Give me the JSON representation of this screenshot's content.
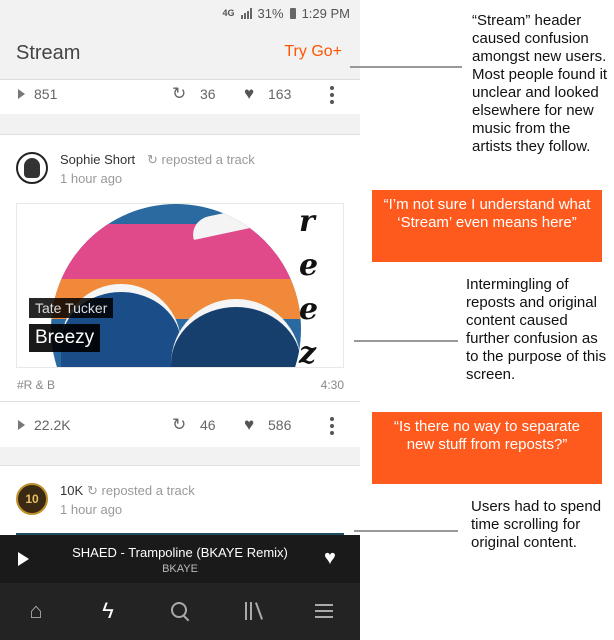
{
  "status_bar": {
    "network": "4G",
    "battery": "31%",
    "time": "1:29 PM"
  },
  "header": {
    "title": "Stream",
    "try_go": "Try Go+"
  },
  "top_actions": {
    "plays": "851",
    "reposts": "36",
    "likes": "163"
  },
  "posts": [
    {
      "user": "Sophie Short",
      "action": "reposted a track",
      "time": "1 hour ago",
      "artist": "Tate Tucker",
      "track": "Breezy",
      "art_glyphs": [
        "r",
        "e",
        "e",
        "z"
      ],
      "tag": "#R & B",
      "duration": "4:30",
      "plays": "22.2K",
      "reposts": "46",
      "likes": "586"
    },
    {
      "user": "10K",
      "action": "reposted a track",
      "time": "1 hour ago",
      "avatar_text": "10"
    }
  ],
  "player": {
    "title": "SHAED - Trampoline (BKAYE Remix)",
    "artist": "BKAYE"
  },
  "icons": {
    "repost": "↻",
    "heart": "♥",
    "home": "⌂",
    "bolt": "ϟ"
  },
  "annotations": {
    "note1": "“Stream” header caused confusion amongst new users. Most people found it unclear and looked elsewhere for new music from  the artists they follow.",
    "quote1": "“I’m not sure I understand what ‘Stream’ even means here”",
    "note2": "Intermingling of reposts and original content caused further confusion as to the purpose of this screen.",
    "quote2": "“Is there no way to separate new stuff from reposts?”",
    "note3": "Users had to spend time scrolling for original content."
  },
  "colors": {
    "accent": "#ff5500",
    "quote_bg": "#ff5a1e",
    "player_bg": "#1a1a1a",
    "nav_bg": "#232323"
  }
}
